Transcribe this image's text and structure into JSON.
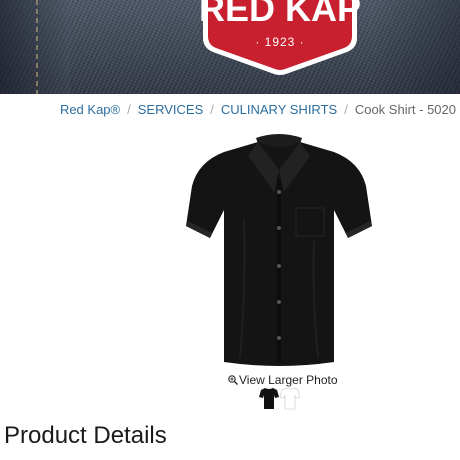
{
  "brand": {
    "logo_text": "RED KAP",
    "logo_year": "· 1923 ·",
    "colors": {
      "red": "#c8202f",
      "white": "#ffffff",
      "denim": "#3c4554"
    }
  },
  "breadcrumb": {
    "items": [
      "Red Kap®",
      "SERVICES",
      "CULINARY SHIRTS"
    ],
    "current": "Cook Shirt - 5020",
    "separator": "/",
    "link_color": "#2c6e9e"
  },
  "product": {
    "image_icon": "black-shirt-image",
    "view_larger_label": "View Larger Photo",
    "zoom_icon": "magnifier-plus-icon",
    "swatches": [
      {
        "name": "black",
        "color": "#111111"
      },
      {
        "name": "white",
        "color": "#ffffff"
      }
    ]
  },
  "section": {
    "title": "Product Details"
  }
}
